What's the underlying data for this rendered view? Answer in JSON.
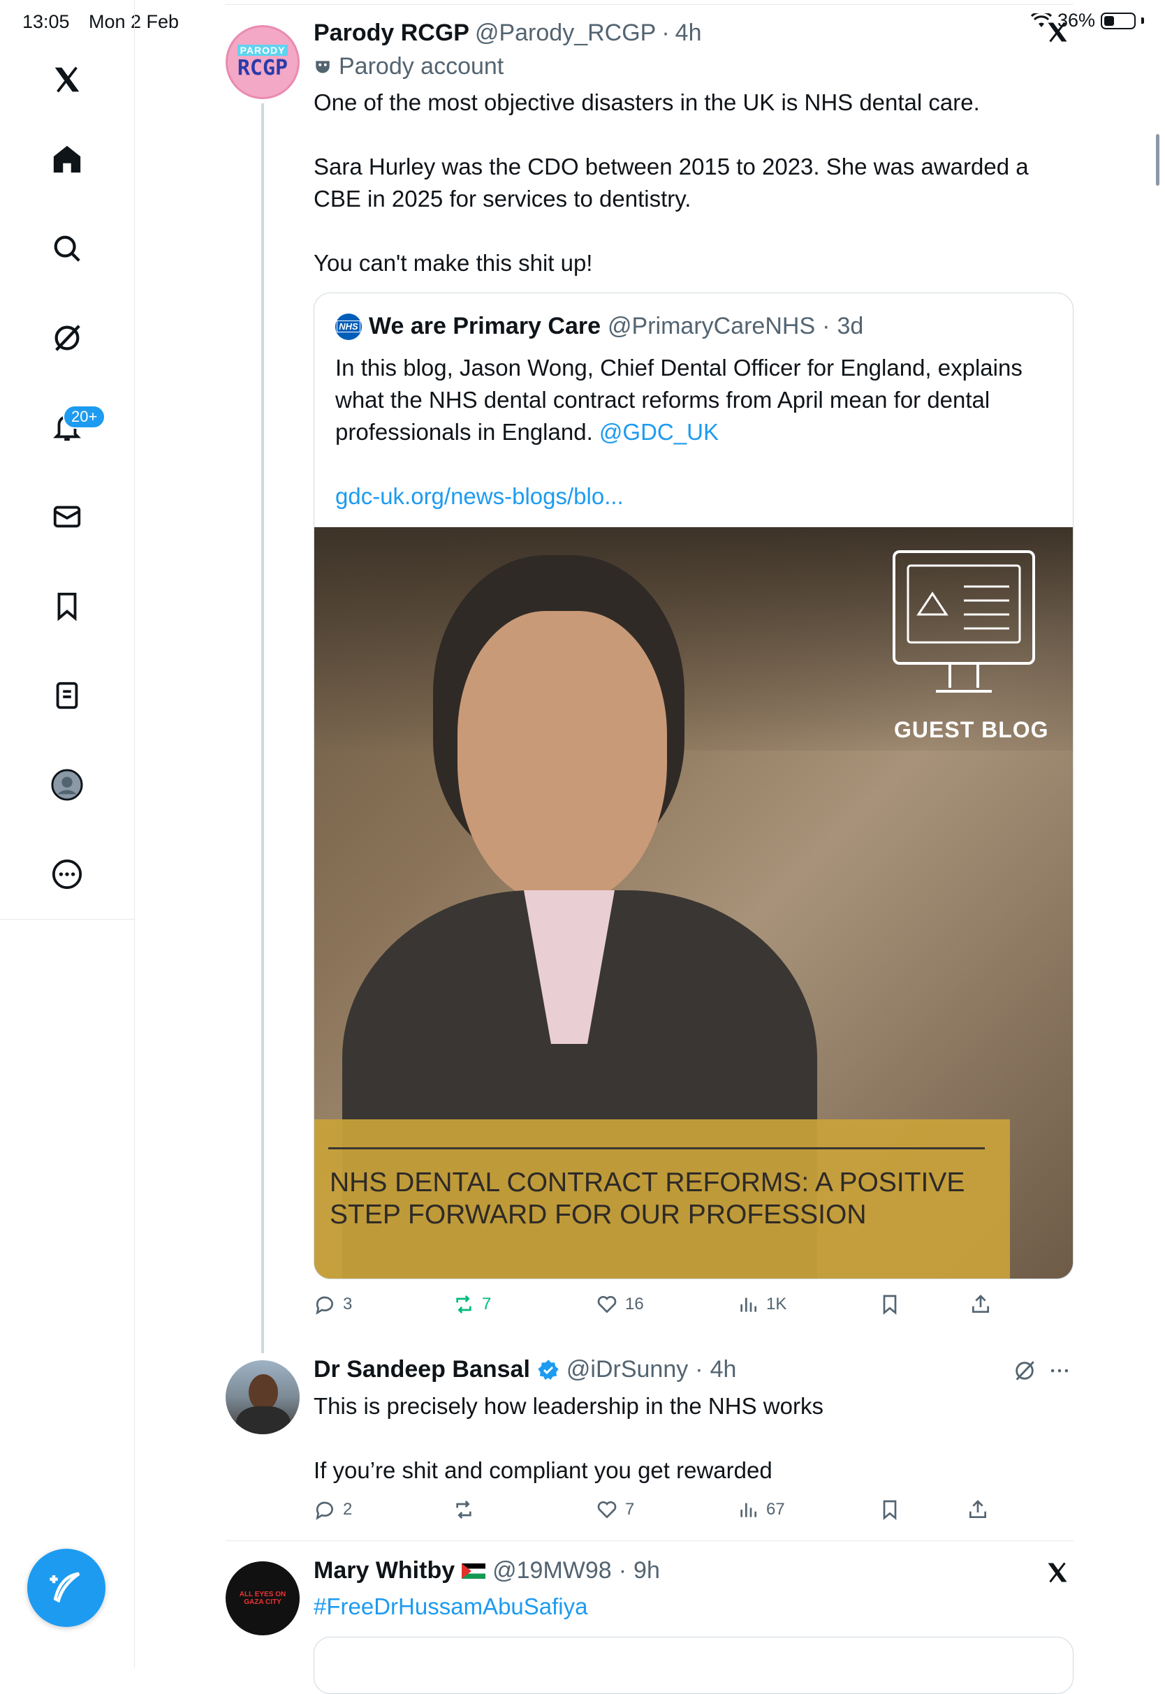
{
  "status_bar": {
    "time": "13:05",
    "date": "Mon 2 Feb",
    "battery": "36%"
  },
  "sidebar": {
    "notifications_badge": "20+"
  },
  "tweet": {
    "avatar": {
      "line1": "PARODY",
      "line2": "RCGP"
    },
    "name": "Parody RCGP",
    "handle": "@Parody_RCGP",
    "time": "4h",
    "label": "Parody account",
    "text": "One of the most objective disasters in the UK is NHS dental care.\n\nSara Hurley was the CDO between 2015 to 2023. She was awarded a CBE in 2025 for services to dentistry.\n\nYou can't make this shit up!",
    "quote": {
      "avatar_text": "NHS",
      "name": "We are Primary Care",
      "handle": "@PrimaryCareNHS",
      "time": "3d",
      "text": "In this blog, Jason Wong, Chief Dental Officer for England, explains what the NHS dental contract reforms from April mean for dental professionals in England.",
      "mention": "@GDC_UK",
      "link": "gdc-uk.org/news-blogs/blo...",
      "image": {
        "badge": "GUEST BLOG",
        "banner": "NHS DENTAL CONTRACT REFORMS: A POSITIVE\nSTEP FORWARD FOR OUR PROFESSION"
      }
    },
    "actions": {
      "replies": "3",
      "reposts": "7",
      "likes": "16",
      "views": "1K"
    }
  },
  "reply": {
    "name": "Dr Sandeep Bansal",
    "handle": "@iDrSunny",
    "time": "4h",
    "text": "This is precisely how leadership in the NHS works\n\nIf you’re shit and compliant you get rewarded",
    "actions": {
      "replies": "2",
      "reposts": "",
      "likes": "7",
      "views": "67"
    }
  },
  "next_tweet": {
    "avatar_text": "ALL EYES ON GAZA CITY",
    "name": "Mary Whitby",
    "handle": "@19MW98",
    "time": "9h",
    "text": "#FreeDrHussamAbuSafiya"
  },
  "colors": {
    "accent": "#1d9bf0",
    "repost_green": "#00ba7c",
    "banner_gold": "#c9a13a"
  },
  "icons": [
    "x-logo",
    "home-icon",
    "search-icon",
    "grok-icon",
    "bell-icon",
    "mail-icon",
    "bookmark-icon",
    "lists-icon",
    "profile-icon",
    "more-icon",
    "compose-icon"
  ]
}
